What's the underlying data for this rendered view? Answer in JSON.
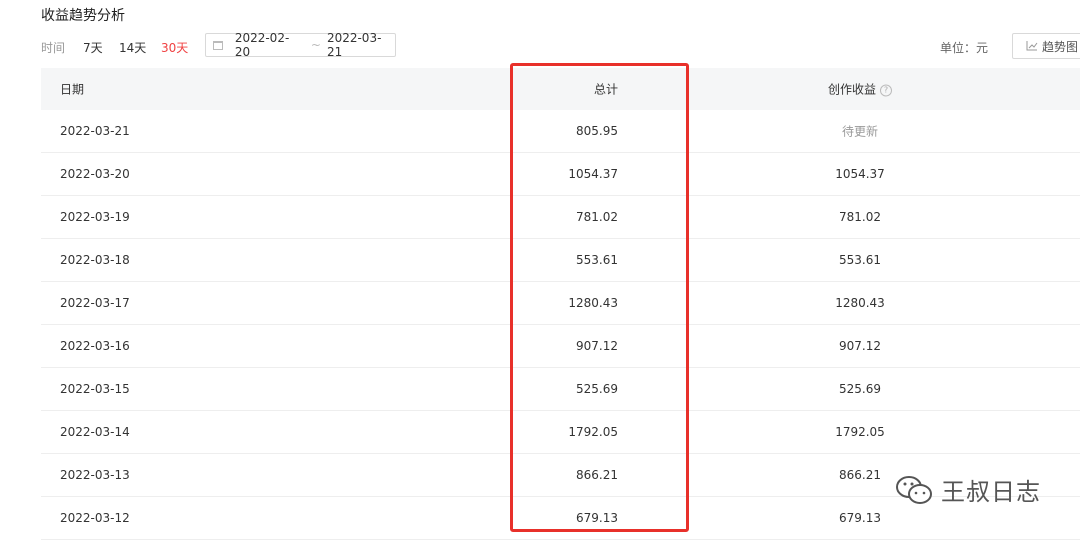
{
  "header": {
    "title": "收益趋势分析"
  },
  "filters": {
    "time_label": "时间",
    "ranges": [
      "7天",
      "14天",
      "30天"
    ],
    "active_range": "30天",
    "start_date": "2022-02-20",
    "separator": "~",
    "end_date": "2022-03-21",
    "unit": "单位：元",
    "trend_button": "趋势图"
  },
  "table": {
    "columns": [
      "日期",
      "总计",
      "创作收益"
    ],
    "rows": [
      {
        "date": "2022-03-21",
        "total": "805.95",
        "creation": "待更新"
      },
      {
        "date": "2022-03-20",
        "total": "1054.37",
        "creation": "1054.37"
      },
      {
        "date": "2022-03-19",
        "total": "781.02",
        "creation": "781.02"
      },
      {
        "date": "2022-03-18",
        "total": "553.61",
        "creation": "553.61"
      },
      {
        "date": "2022-03-17",
        "total": "1280.43",
        "creation": "1280.43"
      },
      {
        "date": "2022-03-16",
        "total": "907.12",
        "creation": "907.12"
      },
      {
        "date": "2022-03-15",
        "total": "525.69",
        "creation": "525.69"
      },
      {
        "date": "2022-03-14",
        "total": "1792.05",
        "creation": "1792.05"
      },
      {
        "date": "2022-03-13",
        "total": "866.21",
        "creation": "866.21"
      },
      {
        "date": "2022-03-12",
        "total": "679.13",
        "creation": "679.13"
      }
    ]
  },
  "watermark": {
    "text": "王叔日志",
    "icon": "wechat-icon"
  },
  "colors": {
    "accent": "#f04142",
    "highlight_box": "#e8302a",
    "header_bg": "#f5f6f7"
  }
}
